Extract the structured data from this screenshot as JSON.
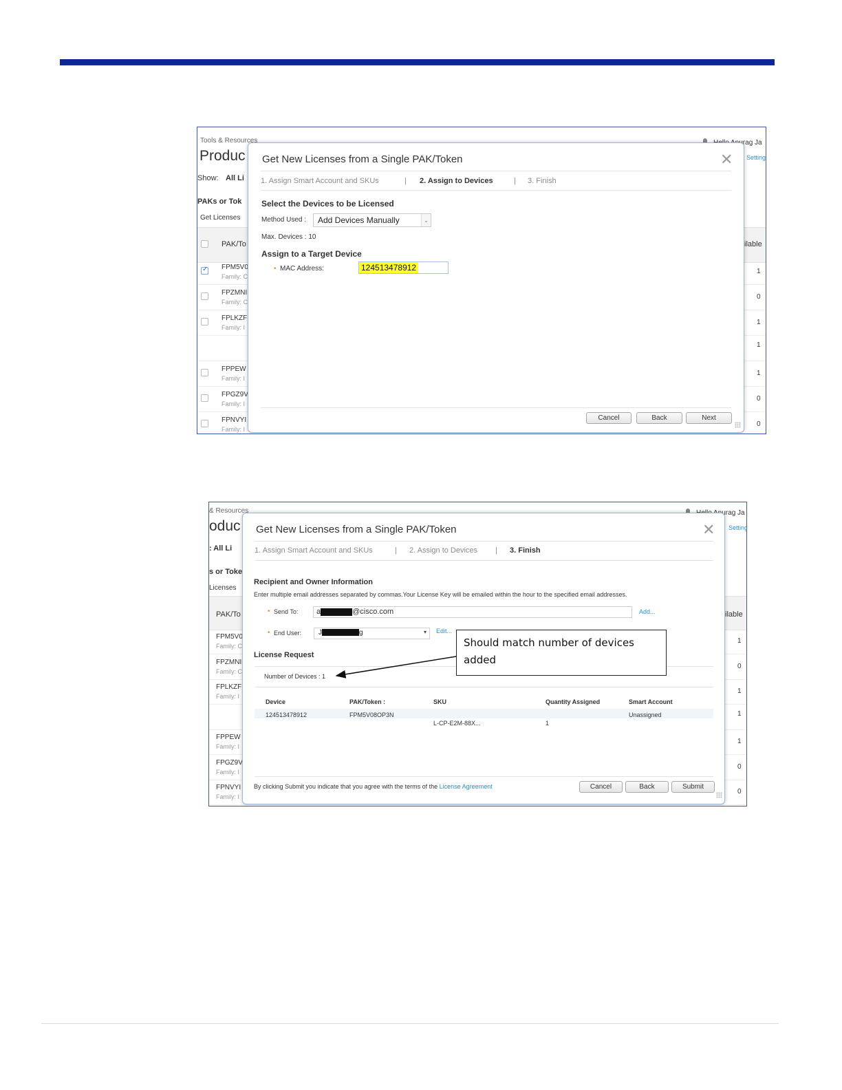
{
  "background": {
    "tools": "Tools & Resources",
    "tools_cropped": "& Resources",
    "product": "Produc",
    "product_cropped": "oduc",
    "show_label": "Show:",
    "show_value": "All Li",
    "show_cropped": ":  All Li",
    "paks_label": "PAKs or Tok",
    "paks_cropped": "s or Toke",
    "get_licenses": "Get Licenses",
    "get_licenses_cropped": "Licenses",
    "pak_col": "PAK/To",
    "avail_col": "ilable",
    "hello": "Hello Anurag Ja",
    "hello_cropped": "Hello Anurag Ja",
    "settings": "Setting",
    "rows": [
      {
        "name": "FPM5V0",
        "family": "Family: C",
        "avail": "1",
        "checked": true
      },
      {
        "name": "FPZMNI",
        "family": "Family: C",
        "avail": "0",
        "checked": false
      },
      {
        "name": "FPLKZF",
        "family": "Family: I",
        "avail": "1",
        "checked": false
      },
      {
        "name": "",
        "family": "",
        "avail": "1",
        "checked": false
      },
      {
        "name": "FPPEW",
        "family": "Family: I",
        "avail": "1",
        "checked": false
      },
      {
        "name": "FPGZ9V",
        "family": "Family: I",
        "avail": "0",
        "checked": false
      },
      {
        "name": "FPNVYI",
        "family": "Family: I",
        "avail": "0",
        "checked": false
      }
    ]
  },
  "dialog1": {
    "title": "Get New Licenses from a Single PAK/Token",
    "steps": [
      "1. Assign Smart Account and SKUs",
      "2. Assign to Devices",
      "3. Finish"
    ],
    "active_step": 1,
    "section_select": "Select the Devices to be Licensed",
    "method_label": "Method Used :",
    "method_value": "Add Devices Manually",
    "max_devices": "Max. Devices : 10",
    "section_assign": "Assign to a Target Device",
    "mac_label": "MAC Address:",
    "mac_value": "124513478912",
    "buttons": {
      "cancel": "Cancel",
      "back": "Back",
      "next": "Next"
    }
  },
  "dialog2": {
    "title": "Get New Licenses from a Single PAK/Token",
    "steps": [
      "1. Assign Smart Account and SKUs",
      "2. Assign to Devices",
      "3. Finish"
    ],
    "active_step": 2,
    "section_recipient": "Recipient and Owner Information",
    "recipient_help": "Enter multiple email addresses separated by commas.Your License Key will be emailed within the hour to the specified email addresses.",
    "send_to_label": "Send To:",
    "send_to_value_visible": "@cisco.com",
    "send_to_prefix": "a",
    "add_link": "Add...",
    "end_user_label": "End User:",
    "end_user_prefix": "J",
    "end_user_suffix": "g",
    "edit_link": "Edit...",
    "section_request": "License Request",
    "num_devices": "Number of Devices : 1",
    "table": {
      "headers": [
        "Device",
        "PAK/Token :",
        "SKU",
        "Quantity Assigned",
        "Smart Account"
      ],
      "rows": [
        {
          "device": "124513478912",
          "pak": "FPM5V08OP3N",
          "sku": "L-CP-E2M-88X...",
          "qty": "1",
          "account": "Unassigned"
        }
      ]
    },
    "footer_text": "By clicking Submit you indicate that you agree with the terms of the",
    "footer_link": "License Agreement",
    "buttons": {
      "cancel": "Cancel",
      "back": "Back",
      "submit": "Submit"
    }
  },
  "callout": {
    "line1": "Should match number of devices",
    "line2": "added"
  },
  "colors": {
    "brand_bar": "#0b2896",
    "highlight": "#ffff2e",
    "link": "#1f8fd8",
    "required": "#e8902a"
  }
}
